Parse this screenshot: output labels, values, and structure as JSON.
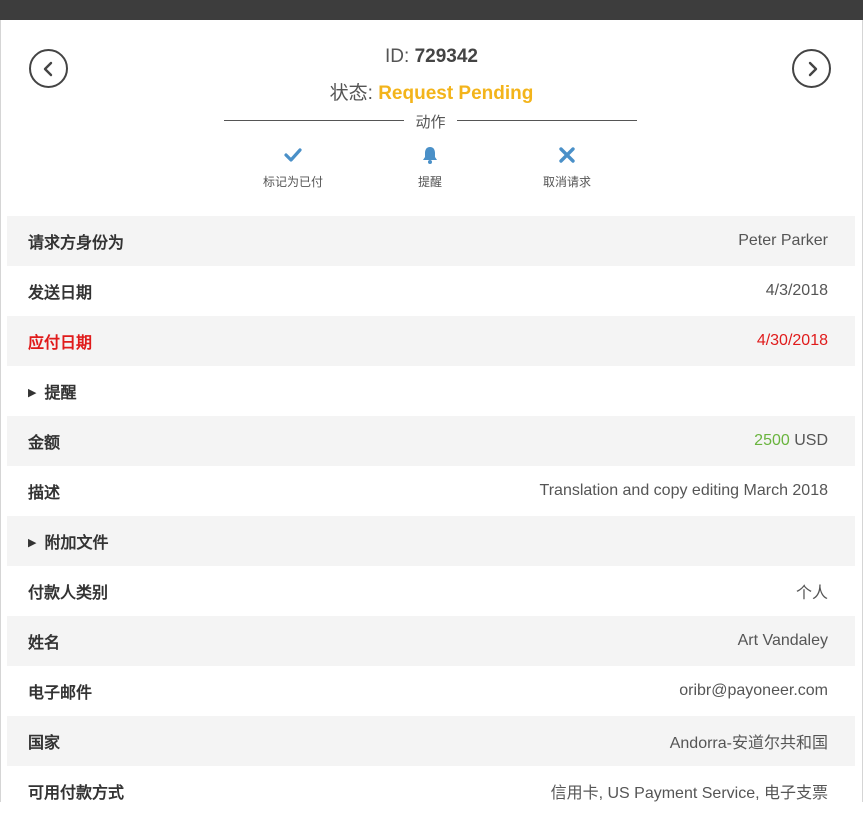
{
  "header": {
    "id_label": "ID:",
    "id_value": "729342",
    "status_label": "状态:",
    "status_value": "Request Pending",
    "actions_title": "动作"
  },
  "actions": [
    {
      "label": "标记为已付",
      "icon": "check-icon"
    },
    {
      "label": "提醒",
      "icon": "bell-icon"
    },
    {
      "label": "取消请求",
      "icon": "x-icon"
    }
  ],
  "details": {
    "requester_label": "请求方身份为",
    "requester_value": "Peter Parker",
    "sent_date_label": "发送日期",
    "sent_date_value": "4/3/2018",
    "due_date_label": "应付日期",
    "due_date_value": "4/30/2018",
    "reminders_label": "提醒",
    "amount_label": "金额",
    "amount_value": "2500",
    "amount_currency": "USD",
    "description_label": "描述",
    "description_value": "Translation and copy editing March 2018",
    "attachments_label": "附加文件",
    "payer_type_label": "付款人类别",
    "payer_type_value": "个人",
    "name_label": "姓名",
    "name_value": "Art Vandaley",
    "email_label": "电子邮件",
    "email_value": "oribr@payoneer.com",
    "country_label": "国家",
    "country_value": "Andorra-安道尔共和国",
    "methods_label": "可用付款方式",
    "methods_value": "信用卡, US Payment Service, 电子支票"
  },
  "colors": {
    "status_pending": "#f3b41b",
    "due": "#e01b1b",
    "amount": "#6ab43e",
    "icon_blue": "#4a90c8"
  }
}
